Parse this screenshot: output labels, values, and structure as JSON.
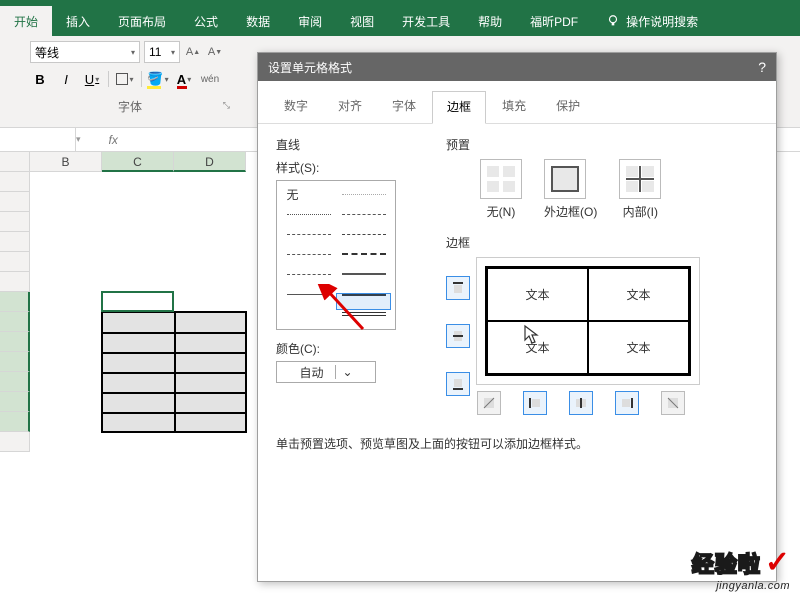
{
  "ribbon": {
    "tabs": [
      "开始",
      "插入",
      "页面布局",
      "公式",
      "数据",
      "审阅",
      "视图",
      "开发工具",
      "帮助",
      "福昕PDF"
    ],
    "tell_me": "操作说明搜索",
    "font_name": "等线",
    "font_size": "11",
    "group_label": "字体",
    "bold": "B",
    "italic": "I",
    "underline": "U"
  },
  "formula_bar": {
    "fx_label": "fx"
  },
  "sheet": {
    "cols": [
      "B",
      "C",
      "D"
    ]
  },
  "dialog": {
    "title": "设置单元格格式",
    "help": "?",
    "tabs": [
      "数字",
      "对齐",
      "字体",
      "边框",
      "填充",
      "保护"
    ],
    "line_title": "直线",
    "style_label": "样式(S):",
    "style_none": "无",
    "color_label": "颜色(C):",
    "color_auto": "自动",
    "preset_title": "预置",
    "presets": {
      "none": "无(N)",
      "outline": "外边框(O)",
      "inside": "内部(I)"
    },
    "border_title": "边框",
    "preview_text": "文本",
    "instruction": "单击预置选项、预览草图及上面的按钮可以添加边框样式。"
  },
  "watermark": {
    "main": "经验啦",
    "check": "✓",
    "sub": "jingyanla.com"
  }
}
